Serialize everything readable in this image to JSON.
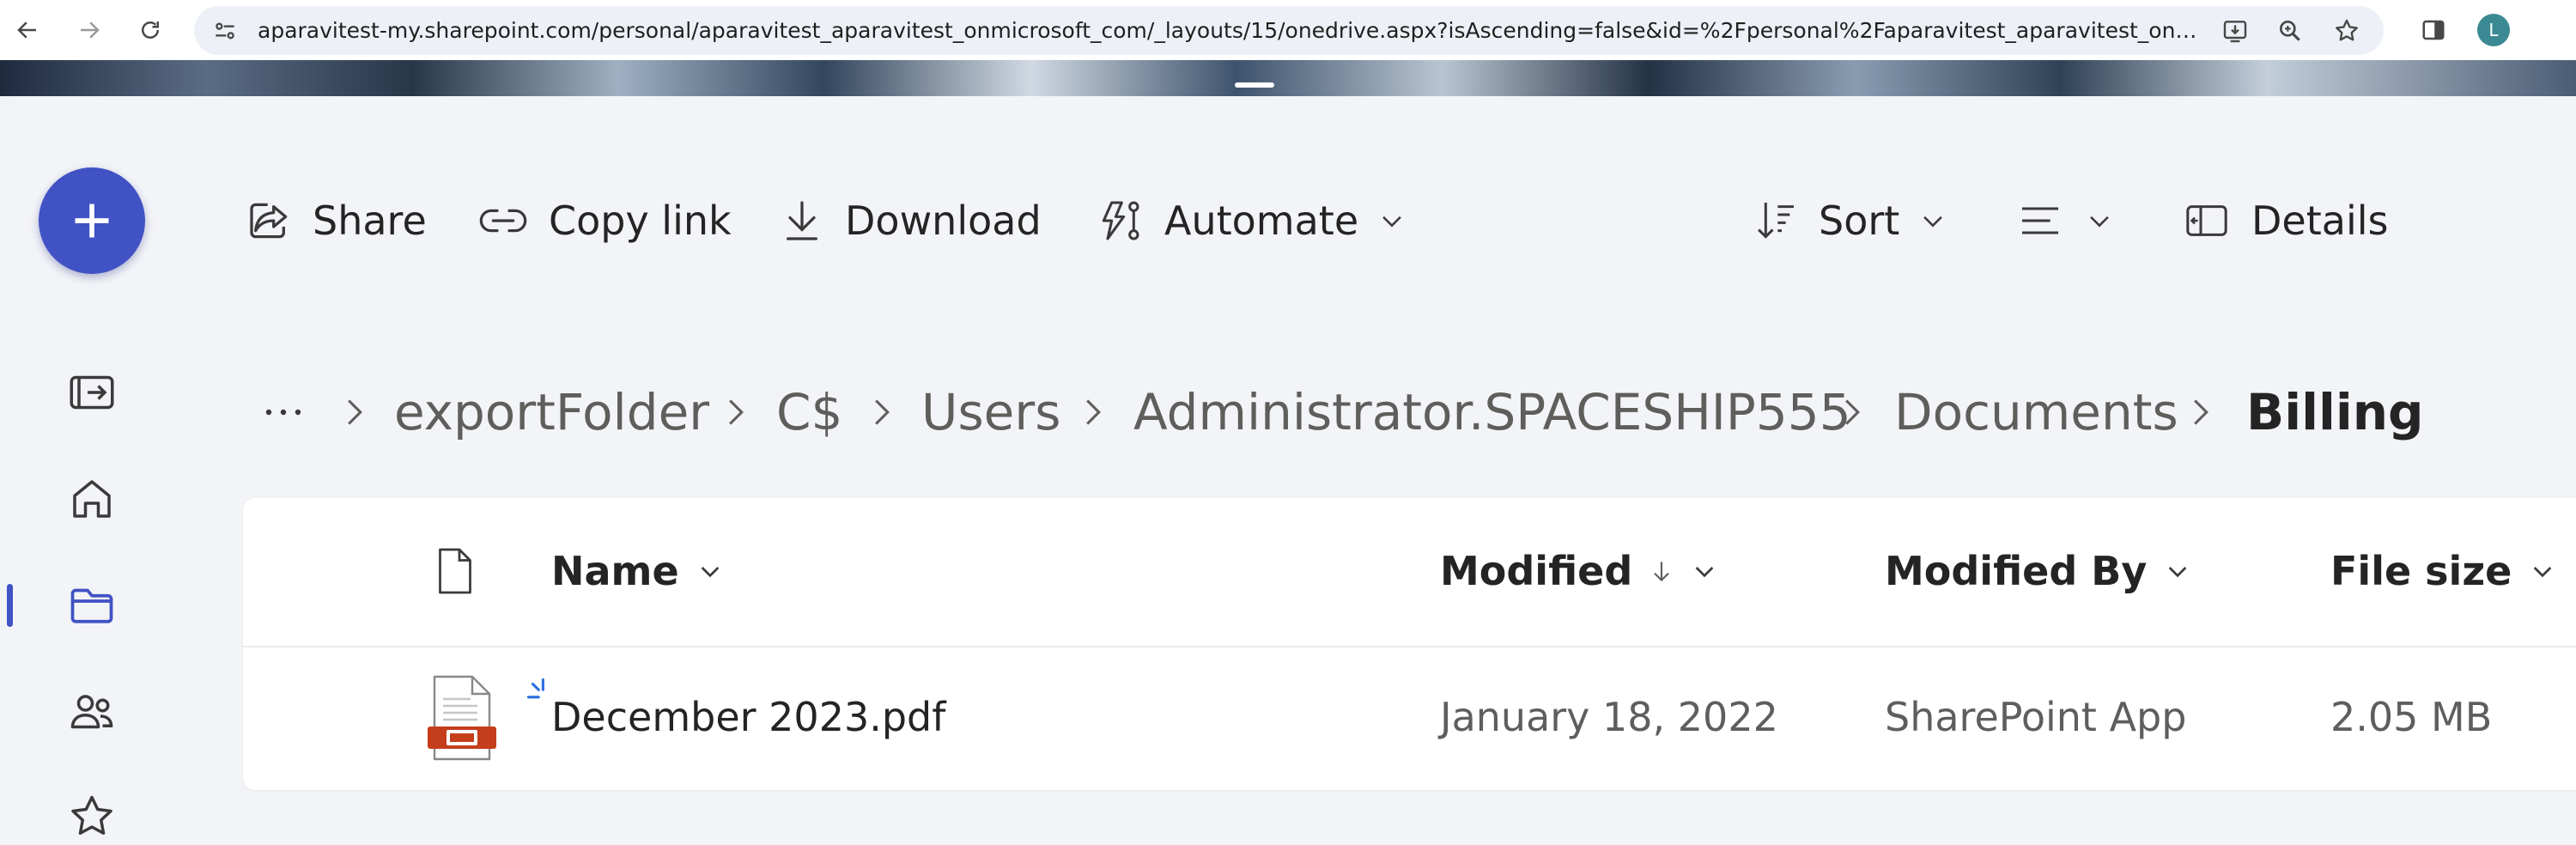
{
  "browser": {
    "url": "aparavitest-my.sharepoint.com/personal/aparavitest_aparavitest_onmicrosoft_com/_layouts/15/onedrive.aspx?isAscending=false&id=%2Fpersonal%2Faparavitest_aparavitest_onmicrosof...",
    "profile_initial": "L"
  },
  "commands": {
    "share": "Share",
    "copy_link": "Copy link",
    "download": "Download",
    "automate": "Automate",
    "sort": "Sort",
    "details": "Details"
  },
  "breadcrumb": {
    "items": [
      "exportFolder",
      "C$",
      "Users",
      "Administrator.SPACESHIP555",
      "Documents"
    ],
    "current": "Billing"
  },
  "table": {
    "columns": {
      "name": "Name",
      "modified": "Modified",
      "modified_by": "Modified By",
      "file_size": "File size"
    },
    "rows": [
      {
        "name": "December 2023.pdf",
        "modified": "January 18, 2022",
        "modified_by": "SharePoint App",
        "file_size": "2.05 MB"
      }
    ]
  },
  "colors": {
    "accent": "#4052c4",
    "pdf_red": "#c43e1c",
    "text_primary": "#242424",
    "text_secondary": "#605e5c",
    "page_bg": "#f3f4f7"
  },
  "icons": [
    "back-icon",
    "forward-icon",
    "reload-icon",
    "site-info-icon",
    "install-app-icon",
    "zoom-icon",
    "bookmark-star-icon",
    "side-panel-icon",
    "plus-icon",
    "pane-toggle-icon",
    "home-icon",
    "folder-icon",
    "people-icon",
    "favorites-star-icon",
    "share-icon",
    "link-icon",
    "download-icon",
    "automate-icon",
    "sort-icon",
    "view-options-icon",
    "details-pane-icon",
    "file-type-icon",
    "pdf-icon",
    "sort-descending-arrow-icon",
    "chevron-down-icon",
    "chevron-right-icon",
    "more-icon"
  ]
}
